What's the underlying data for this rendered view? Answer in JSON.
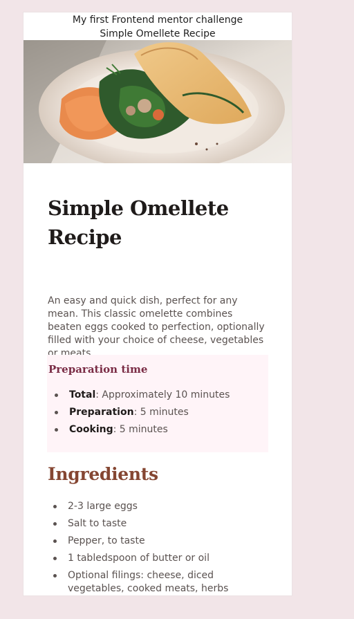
{
  "header": {
    "line1": "My first Frontend mentor challenge",
    "line2": "Simple Omellete Recipe"
  },
  "recipe": {
    "title_line1": "Simple Omellete",
    "title_line2": "Recipe",
    "description": "An easy and quick dish, perfect for any mean. This classic omelette combines beaten eggs cooked to perfection, optionally filled with your choice of cheese, vegetables or meats."
  },
  "preparation": {
    "heading": "Preparation time",
    "items": [
      {
        "label": "Total",
        "text": ": Approximately 10 minutes"
      },
      {
        "label": "Preparation",
        "text": ": 5 minutes"
      },
      {
        "label": "Cooking",
        "text": ": 5 minutes"
      }
    ]
  },
  "ingredients": {
    "heading": "Ingredients",
    "items": [
      "2-3 large eggs",
      "Salt to taste",
      "Pepper, to taste",
      "1 tabledspoon of butter or oil",
      "Optional filings: cheese, diced vegetables, cooked meats, herbs"
    ]
  },
  "colors": {
    "background": "#f2e5e8",
    "card": "#ffffff",
    "title": "#1f1b1a",
    "accent_brown": "#854632",
    "accent_rose": "#7a2c45",
    "prep_background": "#fff4f8"
  }
}
